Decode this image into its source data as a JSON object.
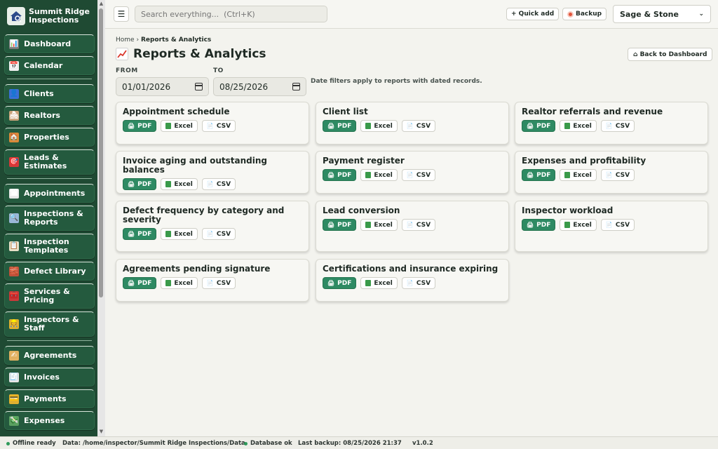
{
  "brand": {
    "name_line1": "Summit Ridge",
    "name_line2": "Inspections"
  },
  "sidebar": {
    "groups": [
      [
        {
          "label": "Dashboard",
          "icon": "bar-chart-icon",
          "glyph": "📊",
          "color": "#7a7a7a"
        },
        {
          "label": "Calendar",
          "icon": "calendar-icon",
          "glyph": "📅",
          "color": "#f2f2f2"
        }
      ],
      [
        {
          "label": "Clients",
          "icon": "person-icon",
          "glyph": "👤",
          "color": "#3b6fd6"
        },
        {
          "label": "Realtors",
          "icon": "houses-icon",
          "glyph": "🏘",
          "color": "#c9a37a"
        },
        {
          "label": "Properties",
          "icon": "house-icon",
          "glyph": "🏠",
          "color": "#d98a3a"
        },
        {
          "label": "Leads & Estimates",
          "icon": "target-icon",
          "glyph": "🎯",
          "color": "#d33a3a",
          "tall": true
        }
      ],
      [
        {
          "label": "Appointments",
          "icon": "calendar-icon",
          "glyph": "🗓",
          "color": "#e6e6e6"
        },
        {
          "label": "Inspections & Reports",
          "icon": "magnifier-icon",
          "glyph": "🔍",
          "color": "#9ab8d8",
          "tall": true
        },
        {
          "label": "Inspection Templates",
          "icon": "clipboard-icon",
          "glyph": "📋",
          "color": "#e8e0c8",
          "tall": true
        },
        {
          "label": "Defect Library",
          "icon": "bricks-icon",
          "glyph": "🧱",
          "color": "#c0503a"
        },
        {
          "label": "Services & Pricing",
          "icon": "toolbox-icon",
          "glyph": "🧰",
          "color": "#c83a3a",
          "tall": true
        },
        {
          "label": "Inspectors & Staff",
          "icon": "staff-icon",
          "glyph": "👷",
          "color": "#e0b030",
          "tall": true
        }
      ],
      [
        {
          "label": "Agreements",
          "icon": "signature-icon",
          "glyph": "✍",
          "color": "#e0b060"
        },
        {
          "label": "Invoices",
          "icon": "receipt-icon",
          "glyph": "🧾",
          "color": "#e6e6e6"
        },
        {
          "label": "Payments",
          "icon": "credit-card-icon",
          "glyph": "💳",
          "color": "#e0b030"
        },
        {
          "label": "Expenses",
          "icon": "money-icon",
          "glyph": "💸",
          "color": "#5aa060"
        }
      ]
    ]
  },
  "topbar": {
    "menu_glyph": "☰",
    "search_placeholder": "Search everything...  (Ctrl+K)",
    "quick_add": "+ Quick add",
    "backup": "Backup",
    "workspace": "Sage & Stone",
    "workspace_chevron": "⌄"
  },
  "breadcrumb": {
    "home": "Home",
    "separator": "›",
    "current": "Reports & Analytics"
  },
  "page": {
    "title": "Reports & Analytics",
    "back_button": "⌂ Back to Dashboard"
  },
  "filters": {
    "from_label": "FROM",
    "from_value": "01/01/2026",
    "to_label": "TO",
    "to_value": "08/25/2026",
    "note": "Date filters apply to reports with dated records."
  },
  "export_labels": {
    "pdf": "PDF",
    "excel": "Excel",
    "csv": "CSV",
    "pdf_glyph": "🖨",
    "csv_glyph": "📄"
  },
  "reports": [
    "Appointment schedule",
    "Client list",
    "Realtor referrals and revenue",
    "Invoice aging and outstanding balances",
    "Payment register",
    "Expenses and profitability",
    "Defect frequency by category and severity",
    "Lead conversion",
    "Inspector workload",
    "Agreements pending signature",
    "Certifications and insurance expiring"
  ],
  "status": {
    "offline": "Offline ready",
    "data_path": "Data: /home/inspector/Summit Ridge Inspections/Data",
    "database": "Database ok",
    "last_backup": "Last backup: 08/25/2026 21:37",
    "version": "v1.0.2"
  },
  "colors": {
    "sidebar": "#1f4a33",
    "accent": "#2e8a63",
    "status_ok": "#2e9a5a"
  }
}
